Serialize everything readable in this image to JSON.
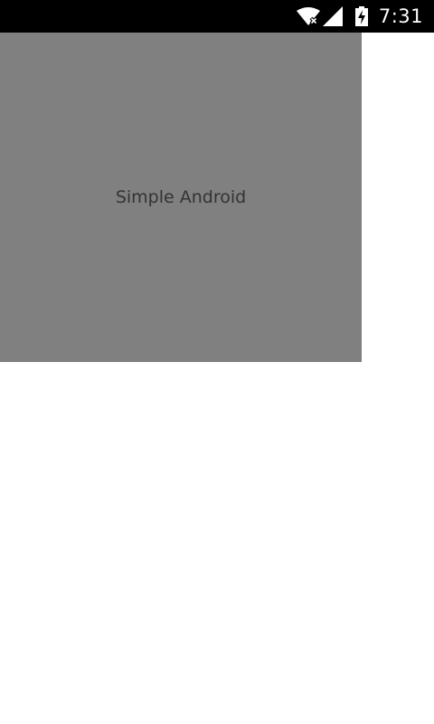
{
  "status_bar": {
    "time": "7:31",
    "icons": [
      "wifi-icon",
      "signal-icon",
      "battery-charging-icon"
    ]
  },
  "main": {
    "text": "Simple Android"
  },
  "colors": {
    "status_bar_bg": "#000000",
    "content_bg": "#808080",
    "text": "#333333",
    "page_bg": "#ffffff"
  }
}
